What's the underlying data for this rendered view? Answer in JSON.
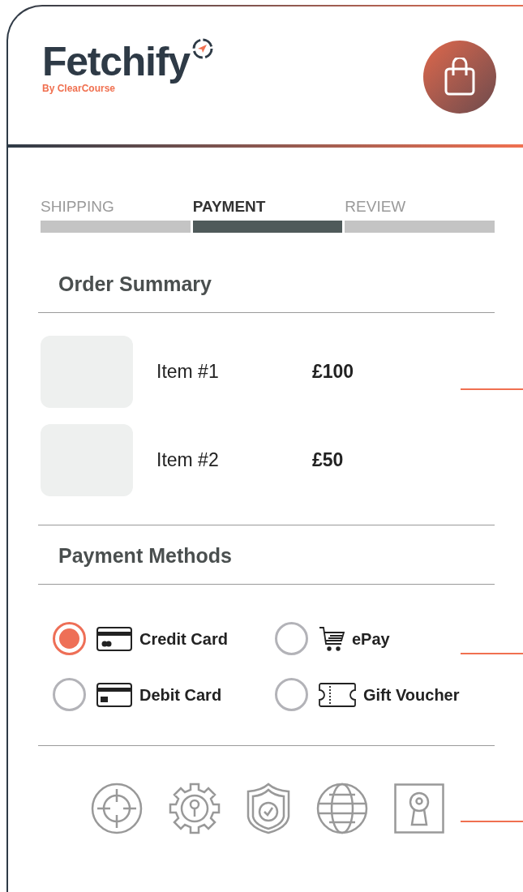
{
  "brand": {
    "name": "Fetchify",
    "tagline": "By ClearCourse"
  },
  "steps": [
    {
      "label": "SHIPPING",
      "selected": false
    },
    {
      "label": "PAYMENT",
      "selected": true
    },
    {
      "label": "REVIEW",
      "selected": false
    }
  ],
  "order_summary": {
    "title": "Order Summary",
    "items": [
      {
        "name": "Item #1",
        "price": "£100"
      },
      {
        "name": "Item #2",
        "price": "£50"
      }
    ]
  },
  "payment_methods": {
    "title": "Payment Methods",
    "options": [
      {
        "kind": "credit",
        "label": "Credit Card",
        "selected": true
      },
      {
        "kind": "cart",
        "label": "ePay",
        "selected": false
      },
      {
        "kind": "debit",
        "label": "Debit Card",
        "selected": false
      },
      {
        "kind": "voucher",
        "label": "Gift Voucher",
        "selected": false
      }
    ]
  }
}
